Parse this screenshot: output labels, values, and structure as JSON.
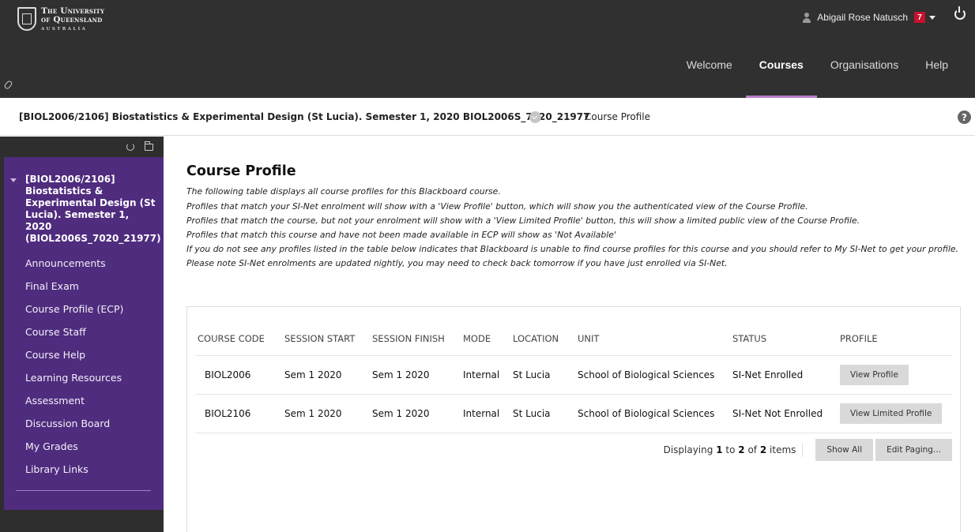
{
  "header": {
    "logo": {
      "line1": "The University",
      "line2": "of Queensland",
      "line3": "AUSTRALIA"
    },
    "user_name": "Abigail Rose Natusch",
    "notifications": "7",
    "nav": [
      "Welcome",
      "Courses",
      "Organisations",
      "Help"
    ],
    "active_nav": "Courses"
  },
  "course_bar": {
    "title": "[BIOL2006/2106] Biostatistics & Experimental Design (St Lucia). Semester 1, 2020 BIOL2006S_7020_21977",
    "crumb": "Course Profile",
    "help": "?"
  },
  "sidebar": {
    "course_name": "[BIOL2006/2106] Biostatistics & Experimental Design (St Lucia). Semester 1, 2020 (BIOL2006S_7020_21977)",
    "items": [
      {
        "label": "Announcements"
      },
      {
        "label": "Final Exam"
      },
      {
        "label": "Course Profile (ECP)"
      },
      {
        "label": "Course Staff"
      },
      {
        "label": "Course Help"
      },
      {
        "label": "Learning Resources"
      },
      {
        "label": "Assessment"
      },
      {
        "label": "Discussion Board"
      },
      {
        "label": "My Grades"
      },
      {
        "label": "Library Links"
      }
    ]
  },
  "main": {
    "title": "Course Profile",
    "intro": "The following table displays all course profiles for this Blackboard course.",
    "notes": [
      "Profiles that match your SI-Net enrolment will show with a 'View Profile' button, which will show you the authenticated view of the Course Profile.",
      "Profiles that match the course, but not your enrolment will show with a 'View Limited Profile' button, this will show a limited public view of the Course Profile.",
      "Profiles that match this course and have not been made available in ECP will show as 'Not Available'",
      "If you do not see any profiles listed in the table below indicates that Blackboard is unable to find course profiles for this course and you should refer to My SI-Net to get your profile.",
      "Please note SI-Net enrolments are updated nightly, you may need to check back tomorrow if you have just enrolled via SI-Net."
    ],
    "table": {
      "headers": [
        "COURSE CODE",
        "SESSION START",
        "SESSION FINISH",
        "MODE",
        "LOCATION",
        "UNIT",
        "STATUS",
        "PROFILE"
      ],
      "rows": [
        {
          "code": "BIOL2006",
          "start": "Sem 1 2020",
          "finish": "Sem 1 2020",
          "mode": "Internal",
          "location": "St Lucia",
          "unit": "School of Biological Sciences",
          "status": "SI-Net Enrolled",
          "button": "View Profile"
        },
        {
          "code": "BIOL2106",
          "start": "Sem 1 2020",
          "finish": "Sem 1 2020",
          "mode": "Internal",
          "location": "St Lucia",
          "unit": "School of Biological Sciences",
          "status": "SI-Net Not Enrolled",
          "button": "View Limited Profile"
        }
      ]
    },
    "paging": {
      "prefix": "Displaying",
      "from": "1",
      "to_word": "to",
      "to": "2",
      "of_word": "of",
      "total": "2",
      "suffix": "items",
      "show_all": "Show All",
      "edit_paging": "Edit Paging..."
    }
  },
  "colors": {
    "header_bg": "#303030",
    "sidebar_bg": "#4f2c7e",
    "nav_active_underline": "#b87ec7",
    "badge": "#c8102e"
  }
}
